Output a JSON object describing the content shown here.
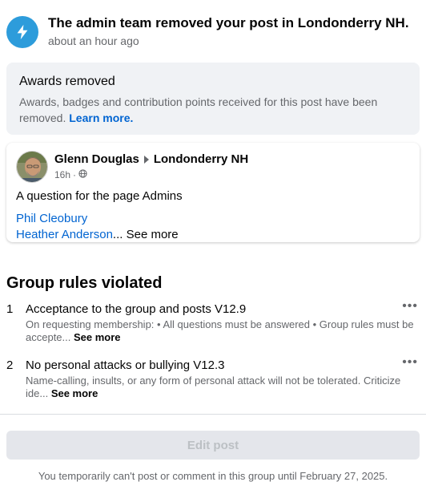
{
  "notification": {
    "title": "The admin team removed your post in Londonderry NH.",
    "time": "about an hour ago",
    "icon": "lightning-bolt-icon",
    "icon_color": "#2d9cdb"
  },
  "awards": {
    "title": "Awards removed",
    "body": "Awards, badges and contribution points received for this post have been removed.",
    "link": "Learn more."
  },
  "post": {
    "author": "Glenn Douglas",
    "group": "Londonderry NH",
    "time": "16h",
    "audience_icon": "globe-icon",
    "text": "A question for the page Admins",
    "mention1": "Phil Cleobury",
    "mention2": "Heather Anderson",
    "ellipsis": "...",
    "see_more": "See more"
  },
  "rules": {
    "title": "Group rules violated",
    "items": [
      {
        "num": "1",
        "title": "Acceptance to the group and posts V12.9",
        "desc": "On requesting membership: • All questions must be answered • Group rules must be accepte...",
        "see_more": "See more",
        "menu": "•••"
      },
      {
        "num": "2",
        "title": "No personal attacks or bullying V12.3",
        "desc": "Name-calling, insults, or any form of personal attack will not be tolerated. Criticize ide...",
        "see_more": "See more",
        "menu": "•••"
      }
    ]
  },
  "actions": {
    "edit_post": "Edit post"
  },
  "footer": {
    "note": "You temporarily can't post or comment in this group until February 27, 2025."
  },
  "colors": {
    "link": "#0064d1",
    "secondary_text": "#65676b",
    "panel_bg": "#f0f2f5",
    "disabled_button_bg": "#e4e6eb"
  }
}
